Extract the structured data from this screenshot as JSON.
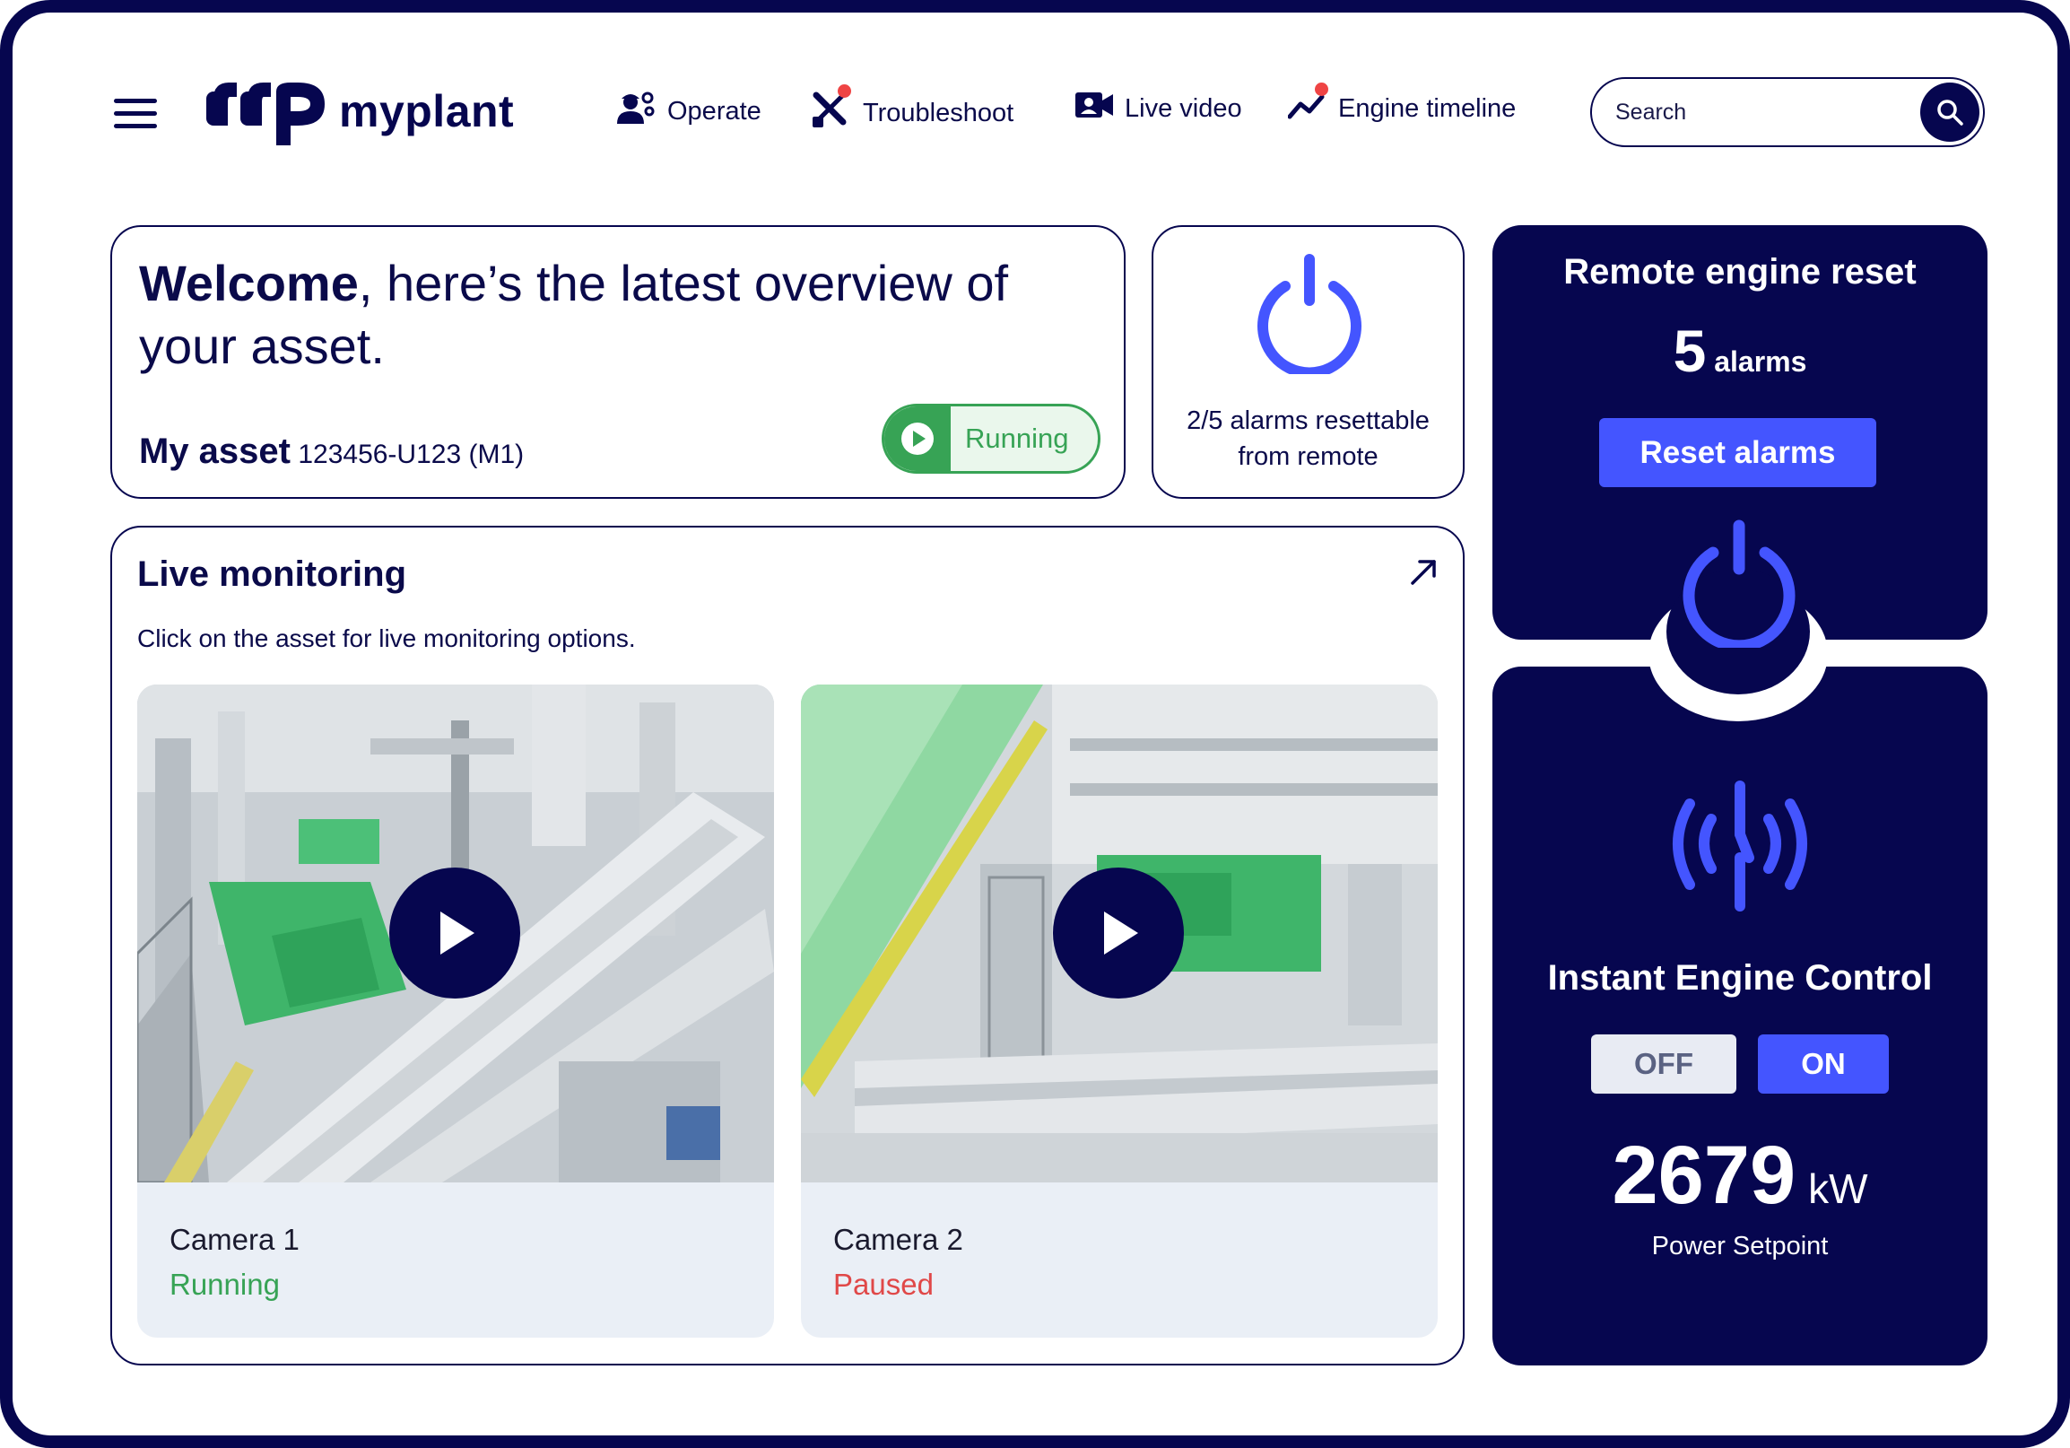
{
  "app": {
    "logo_text": "myplant"
  },
  "nav": {
    "items": [
      {
        "label": "Operate",
        "icon": "operator-icon"
      },
      {
        "label": "Troubleshoot",
        "icon": "tools-icon",
        "notification": true
      },
      {
        "label": "Live video",
        "icon": "video-camera-icon"
      },
      {
        "label": "Engine timeline",
        "icon": "trend-line-icon",
        "notification": true
      }
    ]
  },
  "search": {
    "placeholder": "Search",
    "value": ""
  },
  "welcome": {
    "headline_bold": "Welcome",
    "headline_rest": ", here’s the latest overview of your asset.",
    "asset_label": "My asset",
    "asset_id": "123456-U123 (M1)",
    "status": "Running"
  },
  "alarms_summary": {
    "text_line1": "2/5 alarms resettable",
    "text_line2": "from remote"
  },
  "live_monitoring": {
    "title": "Live monitoring",
    "subtitle": "Click on the asset for live monitoring options.",
    "cameras": [
      {
        "name": "Camera 1",
        "status": "Running",
        "status_color": "#37a355"
      },
      {
        "name": "Camera 2",
        "status": "Paused",
        "status_color": "#e04848"
      }
    ]
  },
  "remote_reset": {
    "title": "Remote engine reset",
    "alarm_count": "5",
    "alarm_unit": "alarms",
    "button_label": "Reset alarms"
  },
  "engine_control": {
    "title": "Instant Engine Control",
    "off_label": "OFF",
    "on_label": "ON",
    "active": "ON",
    "power_value": "2679",
    "power_unit": "kW",
    "power_label": "Power Setpoint"
  },
  "colors": {
    "navy": "#06064f",
    "accent_blue": "#4455ff",
    "running_green": "#37a355",
    "paused_red": "#e04848",
    "notification_red": "#ef4444"
  }
}
